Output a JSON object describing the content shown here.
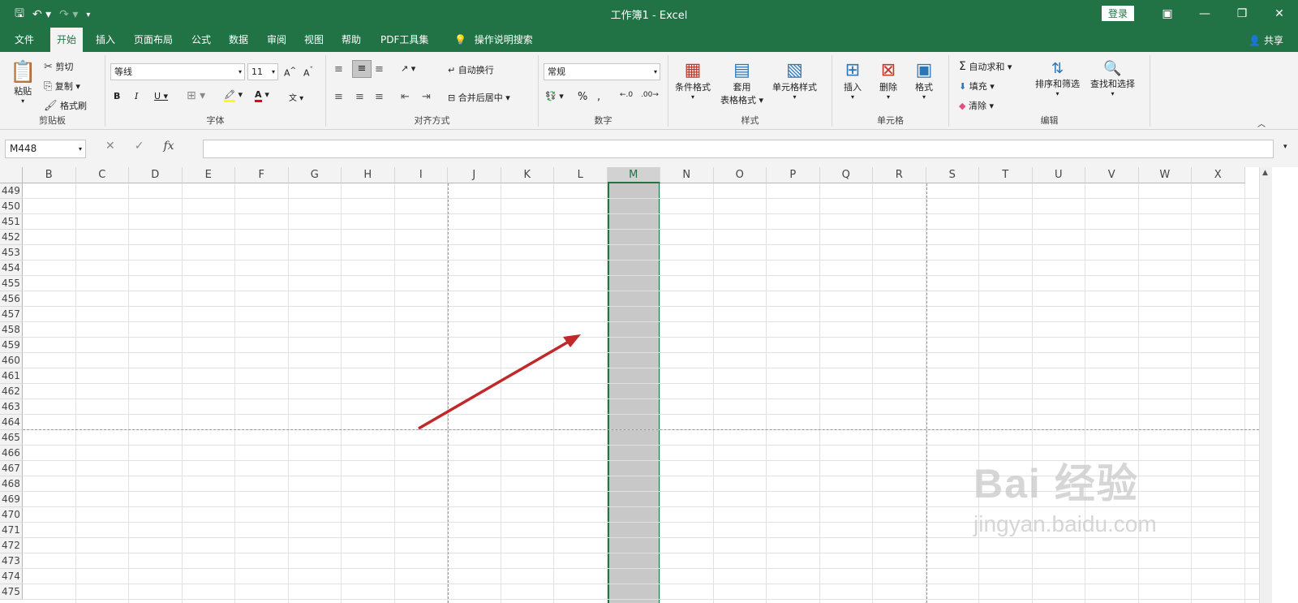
{
  "titlebar": {
    "title": "工作簿1  -  Excel",
    "login": "登录"
  },
  "tabs": [
    "文件",
    "开始",
    "插入",
    "页面布局",
    "公式",
    "数据",
    "审阅",
    "视图",
    "帮助",
    "PDF工具集",
    "操作说明搜索"
  ],
  "share": "共享",
  "ribbon": {
    "clipboard": {
      "paste": "粘贴",
      "cut": "剪切",
      "copy": "复制",
      "painter": "格式刷",
      "label": "剪贴板"
    },
    "font": {
      "name": "等线",
      "size": "11",
      "label": "字体"
    },
    "align": {
      "wrap": "自动换行",
      "merge": "合并后居中",
      "label": "对齐方式"
    },
    "number": {
      "format": "常规",
      "label": "数字"
    },
    "styles": {
      "cond": "条件格式",
      "table_l1": "套用",
      "table_l2": "表格格式",
      "cell": "单元格样式",
      "label": "样式"
    },
    "cells": {
      "insert": "插入",
      "delete": "删除",
      "format": "格式",
      "label": "单元格"
    },
    "edit": {
      "autosum": "自动求和",
      "fill": "填充",
      "clear": "清除",
      "sort": "排序和筛选",
      "find": "查找和选择",
      "label": "编辑"
    }
  },
  "formula": {
    "namebox": "M448"
  },
  "columns": [
    "B",
    "C",
    "D",
    "E",
    "F",
    "G",
    "H",
    "I",
    "J",
    "K",
    "L",
    "M",
    "N",
    "O",
    "P",
    "Q",
    "R",
    "S",
    "T",
    "U",
    "V",
    "W",
    "X"
  ],
  "selected_column": "M",
  "rows": [
    "449",
    "450",
    "451",
    "452",
    "453",
    "454",
    "455",
    "456",
    "457",
    "458",
    "459",
    "460",
    "461",
    "462",
    "463",
    "464",
    "465",
    "466",
    "467",
    "468",
    "469",
    "470",
    "471",
    "472",
    "473",
    "474",
    "475"
  ],
  "annotation": {
    "arrow_color": "#c0282a"
  },
  "watermark": {
    "main": "Bai 经验",
    "sub": "jingyan.baidu.com"
  }
}
